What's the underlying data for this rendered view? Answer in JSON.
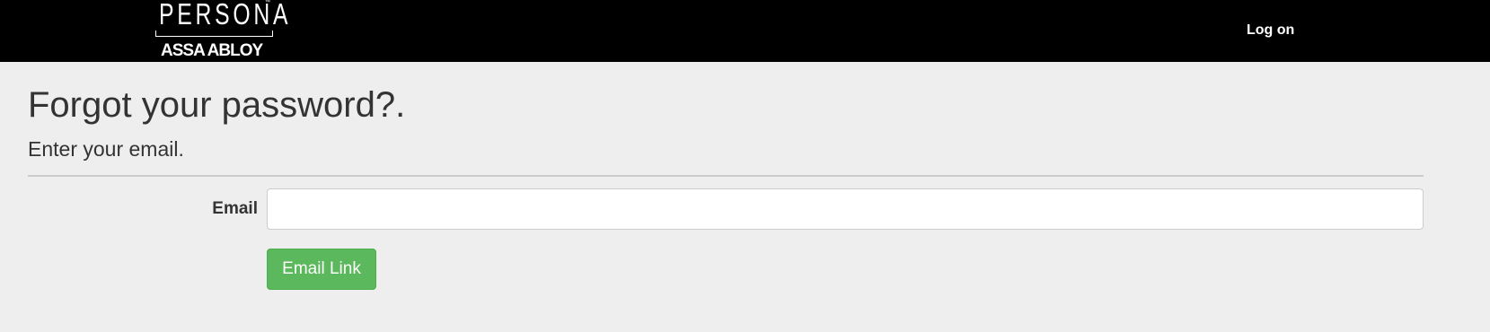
{
  "header": {
    "logo": {
      "brand": "PERSONA",
      "trademark": "™",
      "company": "ASSA ABLOY"
    },
    "nav": {
      "logon_label": "Log on"
    }
  },
  "main": {
    "title": "Forgot your password?.",
    "subtitle": "Enter your email.",
    "form": {
      "email_label": "Email",
      "email_value": "",
      "email_placeholder": "",
      "submit_label": "Email Link"
    }
  },
  "colors": {
    "navbar_background": "#000000",
    "page_background": "#eeeeee",
    "button_background": "#5cb85c",
    "text": "#333333"
  }
}
